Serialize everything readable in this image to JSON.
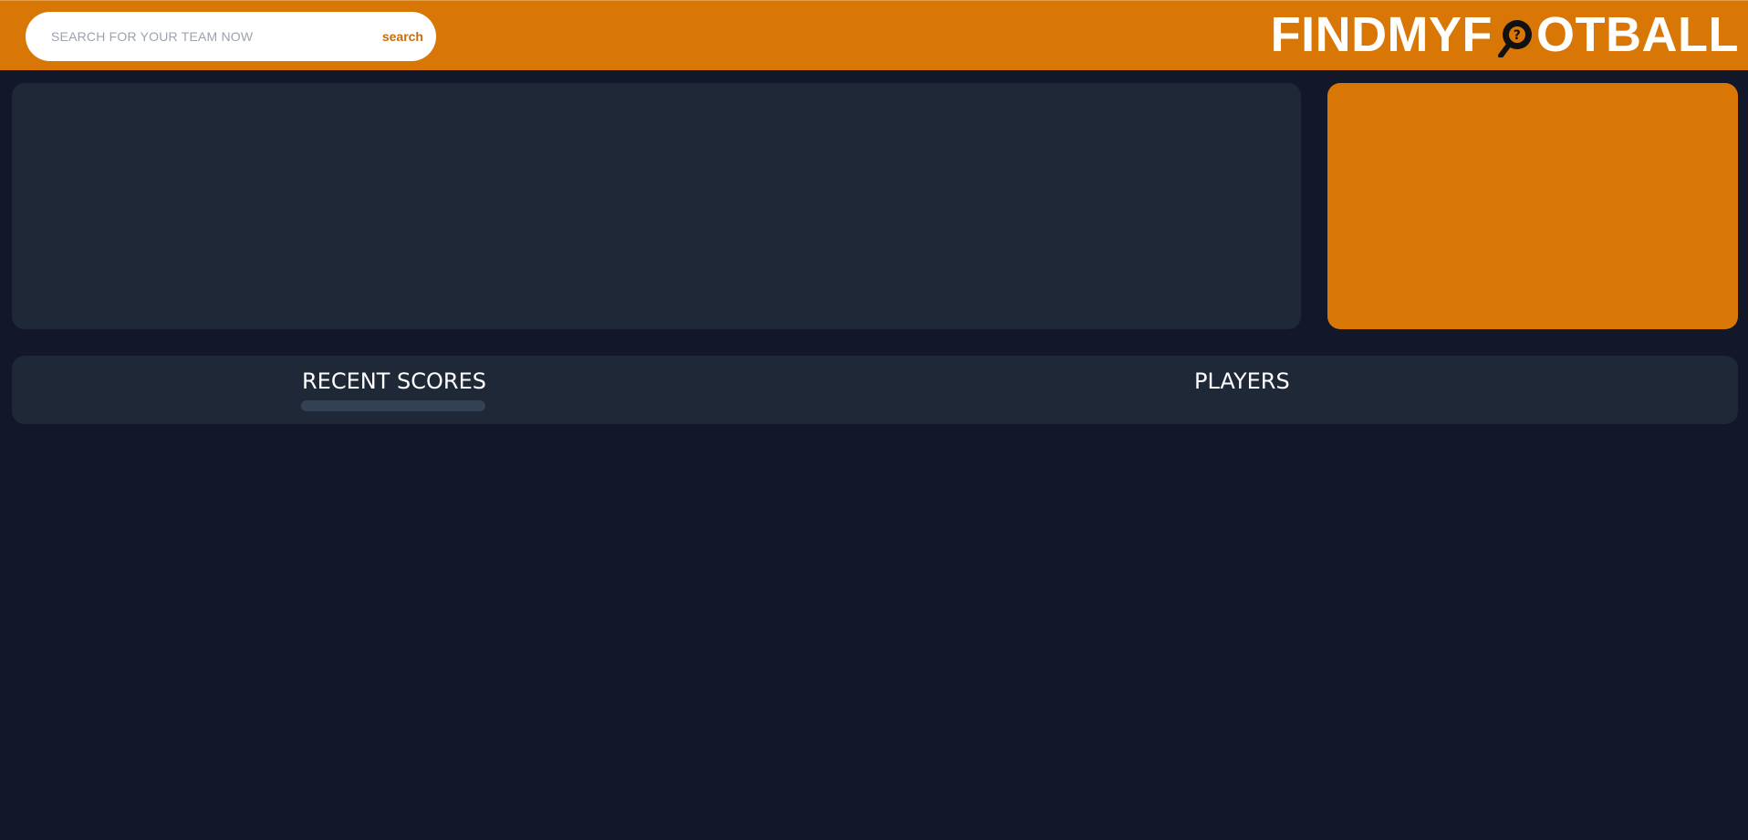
{
  "header": {
    "search": {
      "placeholder": "SEARCH FOR YOUR TEAM NOW",
      "value": "",
      "button_label": "search"
    },
    "logo": {
      "text_before": "FINDMYF",
      "text_after": "OTBALL",
      "icon": "magnifier-question-icon"
    }
  },
  "tabs": [
    {
      "label": "RECENT SCORES",
      "active": true
    },
    {
      "label": "PLAYERS",
      "active": false
    }
  ],
  "colors": {
    "brand_orange": "#d97706",
    "page_background": "#121829",
    "panel_background": "#1f2837",
    "tab_indicator": "#334155",
    "search_button_text": "#c76e0a"
  }
}
